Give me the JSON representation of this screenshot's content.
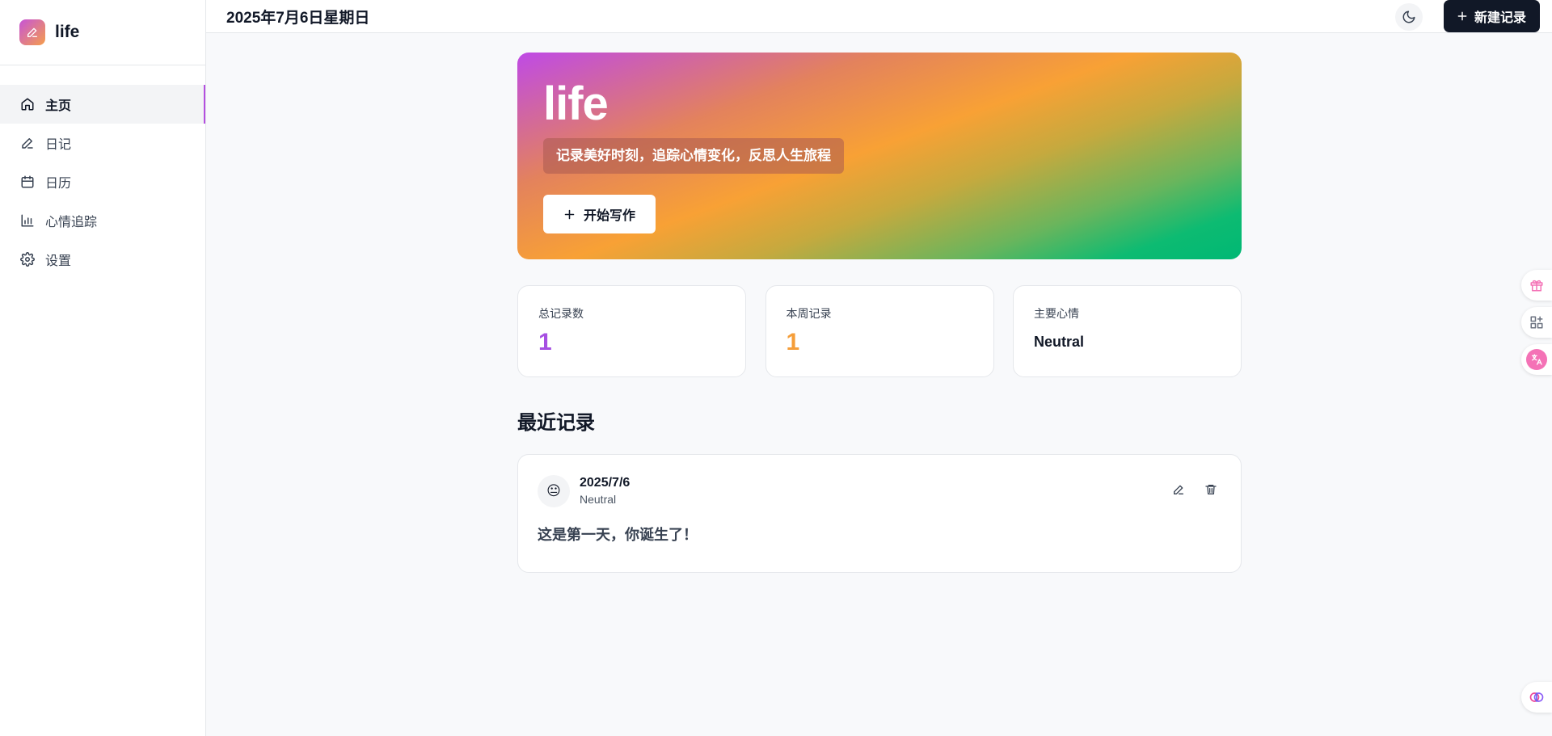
{
  "brand": {
    "name": "life"
  },
  "nav": {
    "items": [
      {
        "label": "主页",
        "icon": "home-icon",
        "active": true
      },
      {
        "label": "日记",
        "icon": "pen-icon",
        "active": false
      },
      {
        "label": "日历",
        "icon": "calendar-icon",
        "active": false
      },
      {
        "label": "心情追踪",
        "icon": "bar-chart-icon",
        "active": false
      },
      {
        "label": "设置",
        "icon": "gear-icon",
        "active": false
      }
    ]
  },
  "topbar": {
    "date": "2025年7月6日星期日",
    "new_label": "新建记录"
  },
  "hero": {
    "title": "life",
    "subtitle": "记录美好时刻，追踪心情变化，反思人生旅程",
    "button_label": "开始写作"
  },
  "stats": [
    {
      "label": "总记录数",
      "value": "1"
    },
    {
      "label": "本周记录",
      "value": "1"
    },
    {
      "label": "主要心情",
      "value": "Neutral"
    }
  ],
  "recent": {
    "title": "最近记录",
    "entries": [
      {
        "date": "2025/7/6",
        "mood": "Neutral",
        "emoji": "😐",
        "text": "这是第一天，你诞生了！"
      }
    ]
  },
  "colors": {
    "accent": "#b44fe0",
    "purple_stat": "#a64fe2",
    "orange_stat": "#f59e3a",
    "dark_button": "#111827"
  }
}
